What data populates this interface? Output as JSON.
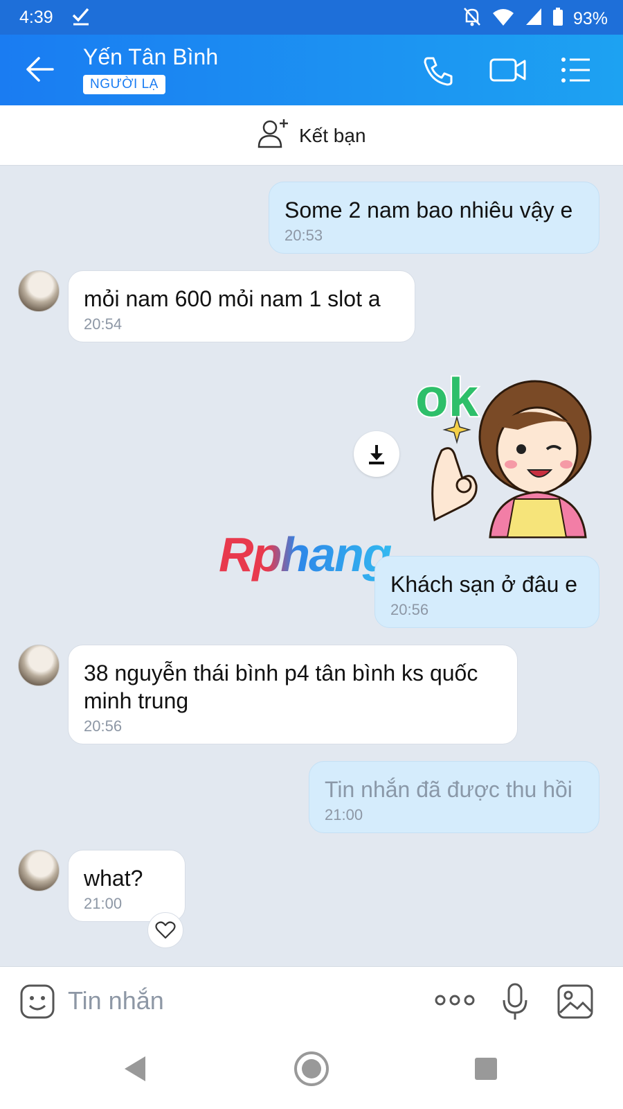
{
  "status_bar": {
    "time": "4:39",
    "battery": "93%"
  },
  "header": {
    "contact_name": "Yến Tân Bình",
    "badge": "NGƯỜI LẠ"
  },
  "friend_bar": {
    "label": "Kết bạn"
  },
  "messages": [
    {
      "direction": "out",
      "text": "Some 2 nam bao nhiêu vậy e",
      "time": "20:53"
    },
    {
      "direction": "in",
      "text": "mỏi nam 600 mỏi nam 1 slot a",
      "time": "20:54"
    },
    {
      "direction": "out",
      "type": "sticker",
      "sticker_text": "ok"
    },
    {
      "direction": "out",
      "text": "Khách sạn ở đâu e",
      "time": "20:56"
    },
    {
      "direction": "in",
      "text": "38 nguyễn thái bình p4 tân bình ks quốc minh trung",
      "time": "20:56"
    },
    {
      "direction": "out",
      "text": "Tin nhắn đã được thu hồi",
      "time": "21:00",
      "recalled": true
    },
    {
      "direction": "in",
      "text": "what?",
      "time": "21:00"
    }
  ],
  "watermark": "Rphang",
  "input": {
    "placeholder": "Tin nhắn"
  },
  "colors": {
    "header_start": "#1a7cf2",
    "header_end": "#1da2f2",
    "outgoing_bubble": "#d5ecfc",
    "incoming_bubble": "#ffffff",
    "chat_bg": "#e2e8f0"
  }
}
